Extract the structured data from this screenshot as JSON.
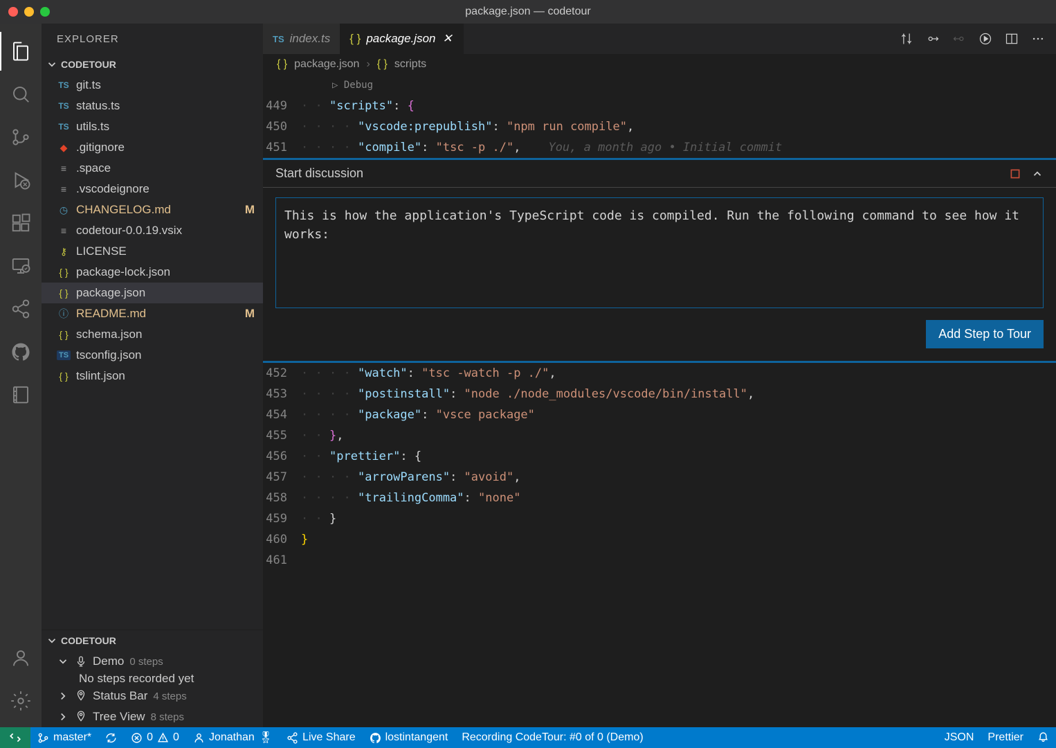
{
  "window": {
    "title": "package.json — codetour"
  },
  "sidebar": {
    "title": "EXPLORER",
    "section": "CODETOUR",
    "files": [
      {
        "name": "git.ts",
        "icon": "ts",
        "modified": false
      },
      {
        "name": "status.ts",
        "icon": "ts",
        "modified": false
      },
      {
        "name": "utils.ts",
        "icon": "ts",
        "modified": false
      },
      {
        "name": ".gitignore",
        "icon": "git",
        "modified": false
      },
      {
        "name": ".space",
        "icon": "text",
        "modified": false
      },
      {
        "name": ".vscodeignore",
        "icon": "text",
        "modified": false
      },
      {
        "name": "CHANGELOG.md",
        "icon": "md-clock",
        "modified": true
      },
      {
        "name": "codetour-0.0.19.vsix",
        "icon": "text",
        "modified": false
      },
      {
        "name": "LICENSE",
        "icon": "license",
        "modified": false
      },
      {
        "name": "package-lock.json",
        "icon": "json",
        "modified": false
      },
      {
        "name": "package.json",
        "icon": "json",
        "modified": false,
        "selected": true
      },
      {
        "name": "README.md",
        "icon": "md-info",
        "modified": true
      },
      {
        "name": "schema.json",
        "icon": "json",
        "modified": false
      },
      {
        "name": "tsconfig.json",
        "icon": "ts-json",
        "modified": false
      },
      {
        "name": "tslint.json",
        "icon": "json",
        "modified": false
      }
    ],
    "codetour_section": "CODETOUR",
    "tours": [
      {
        "name": "Demo",
        "steps": "0 steps",
        "expanded": true,
        "empty_msg": "No steps recorded yet"
      },
      {
        "name": "Status Bar",
        "steps": "4 steps",
        "expanded": false
      },
      {
        "name": "Tree View",
        "steps": "8 steps",
        "expanded": false
      }
    ]
  },
  "tabs": [
    {
      "label": "index.ts",
      "icon": "ts",
      "active": false
    },
    {
      "label": "package.json",
      "icon": "json",
      "active": true
    }
  ],
  "breadcrumb": {
    "file": "package.json",
    "symbol": "scripts"
  },
  "code_top": {
    "debug_lens": "Debug",
    "lines": [
      {
        "num": "449",
        "content": [
          [
            "key",
            "\"scripts\""
          ],
          [
            "punct",
            ": "
          ],
          [
            "brace2",
            "{"
          ]
        ]
      },
      {
        "num": "450",
        "content": [
          [
            "key",
            "\"vscode:prepublish\""
          ],
          [
            "punct",
            ": "
          ],
          [
            "str",
            "\"npm run compile\""
          ],
          [
            "punct",
            ","
          ]
        ]
      },
      {
        "num": "451",
        "content": [
          [
            "key",
            "\"compile\""
          ],
          [
            "punct",
            ": "
          ],
          [
            "str",
            "\"tsc -p ./\""
          ],
          [
            "punct",
            ","
          ]
        ],
        "blame": "You, a month ago • Initial commit"
      }
    ]
  },
  "discussion": {
    "title": "Start discussion",
    "text": "This is how the application's TypeScript code is compiled. Run the following command to see how it works:",
    "button": "Add Step to Tour"
  },
  "code_bottom": {
    "lines": [
      {
        "num": "452",
        "content": [
          [
            "key",
            "\"watch\""
          ],
          [
            "punct",
            ": "
          ],
          [
            "str",
            "\"tsc -watch -p ./\""
          ],
          [
            "punct",
            ","
          ]
        ]
      },
      {
        "num": "453",
        "content": [
          [
            "key",
            "\"postinstall\""
          ],
          [
            "punct",
            ": "
          ],
          [
            "str",
            "\"node ./node_modules/vscode/bin/install\""
          ],
          [
            "punct",
            ","
          ]
        ]
      },
      {
        "num": "454",
        "content": [
          [
            "key",
            "\"package\""
          ],
          [
            "punct",
            ": "
          ],
          [
            "str",
            "\"vsce package\""
          ]
        ]
      },
      {
        "num": "455",
        "content": [
          [
            "brace2",
            "}"
          ],
          [
            "punct",
            ","
          ]
        ]
      },
      {
        "num": "456",
        "content": [
          [
            "key",
            "\"prettier\""
          ],
          [
            "punct",
            ": {"
          ]
        ]
      },
      {
        "num": "457",
        "content": [
          [
            "key",
            "\"arrowParens\""
          ],
          [
            "punct",
            ": "
          ],
          [
            "str",
            "\"avoid\""
          ],
          [
            "punct",
            ","
          ]
        ]
      },
      {
        "num": "458",
        "content": [
          [
            "key",
            "\"trailingComma\""
          ],
          [
            "punct",
            ": "
          ],
          [
            "str",
            "\"none\""
          ]
        ]
      },
      {
        "num": "459",
        "content": [
          [
            "punct",
            "}"
          ]
        ]
      },
      {
        "num": "460",
        "content": [
          [
            "brace",
            "}"
          ]
        ]
      },
      {
        "num": "461",
        "content": []
      }
    ]
  },
  "statusbar": {
    "branch": "master*",
    "errors": "0",
    "warnings": "0",
    "user": "Jonathan",
    "liveshare": "Live Share",
    "account": "lostintangent",
    "recording": "Recording CodeTour: #0 of 0 (Demo)",
    "lang": "JSON",
    "formatter": "Prettier"
  }
}
